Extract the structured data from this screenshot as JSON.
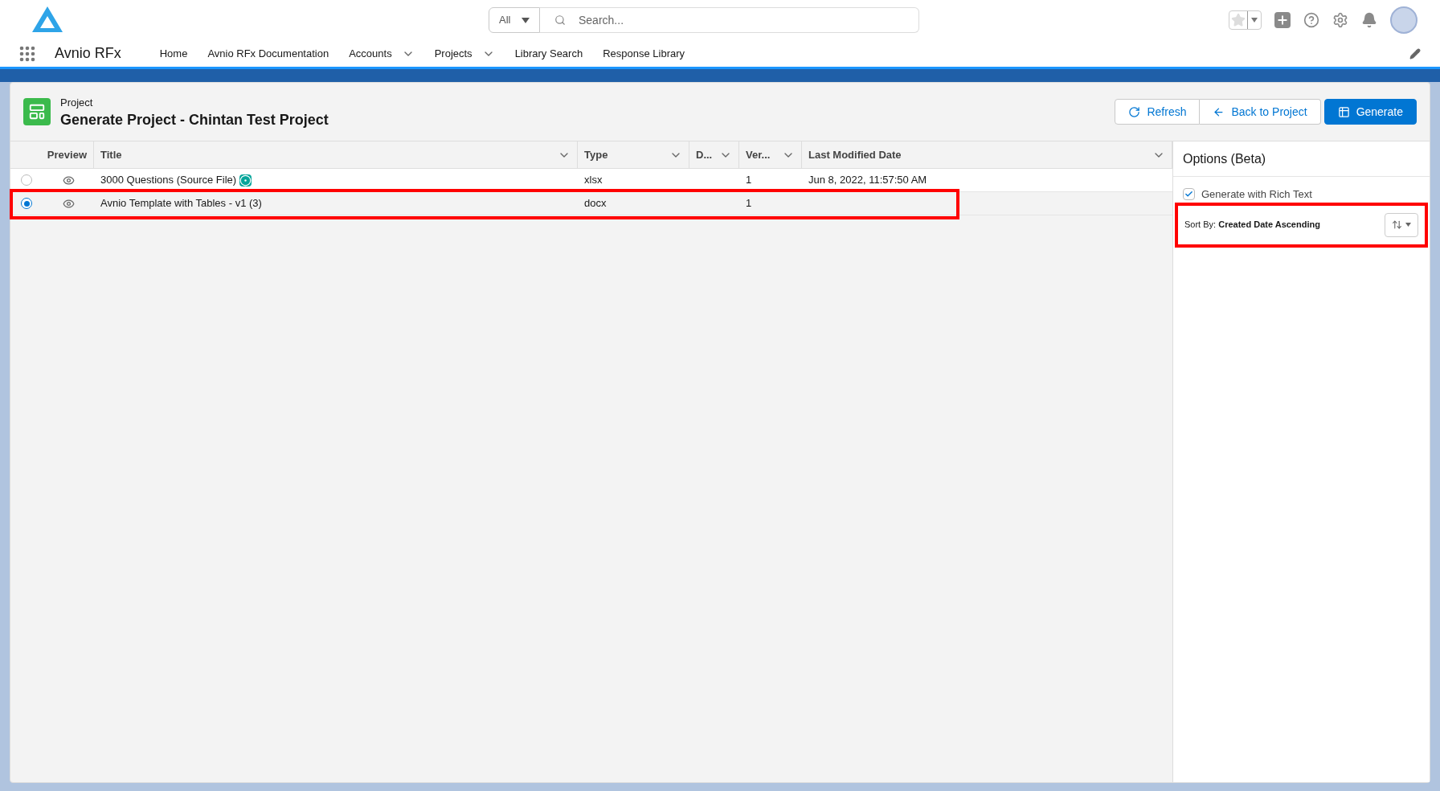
{
  "search": {
    "scope": "All",
    "placeholder": "Search..."
  },
  "app": {
    "name": "Avnio RFx"
  },
  "nav": [
    {
      "label": "Home",
      "has_menu": false
    },
    {
      "label": "Avnio RFx Documentation",
      "has_menu": false
    },
    {
      "label": "Accounts",
      "has_menu": true
    },
    {
      "label": "Projects",
      "has_menu": true
    },
    {
      "label": "Library Search",
      "has_menu": false
    },
    {
      "label": "Response Library",
      "has_menu": false
    }
  ],
  "page": {
    "object": "Project",
    "title": "Generate Project - Chintan Test Project"
  },
  "actions": [
    {
      "label": "Refresh",
      "kind": "refresh"
    },
    {
      "label": "Back to Project",
      "kind": "back"
    },
    {
      "label": "Generate",
      "kind": "primary"
    }
  ],
  "table": {
    "columns": [
      "Preview",
      "Title",
      "Type",
      "D...",
      "Ver...",
      "Last Modified Date"
    ],
    "rows": [
      {
        "selected": false,
        "title": "3000 Questions (Source File)",
        "source": true,
        "highlighted": false,
        "type": "xlsx",
        "version": "1",
        "modified": "Jun 8, 2022, 11:57:50 AM"
      },
      {
        "selected": true,
        "title": "Avnio Template with Tables - v1 (3)",
        "source": false,
        "highlighted": true,
        "type": "docx",
        "version": "1",
        "modified": ""
      }
    ]
  },
  "options": {
    "title": "Options (Beta)",
    "rich_text": {
      "label": "Generate with Rich Text",
      "checked": true
    },
    "sort": {
      "label": "Sort By:",
      "value": "Created Date Ascending",
      "highlighted": true
    }
  }
}
